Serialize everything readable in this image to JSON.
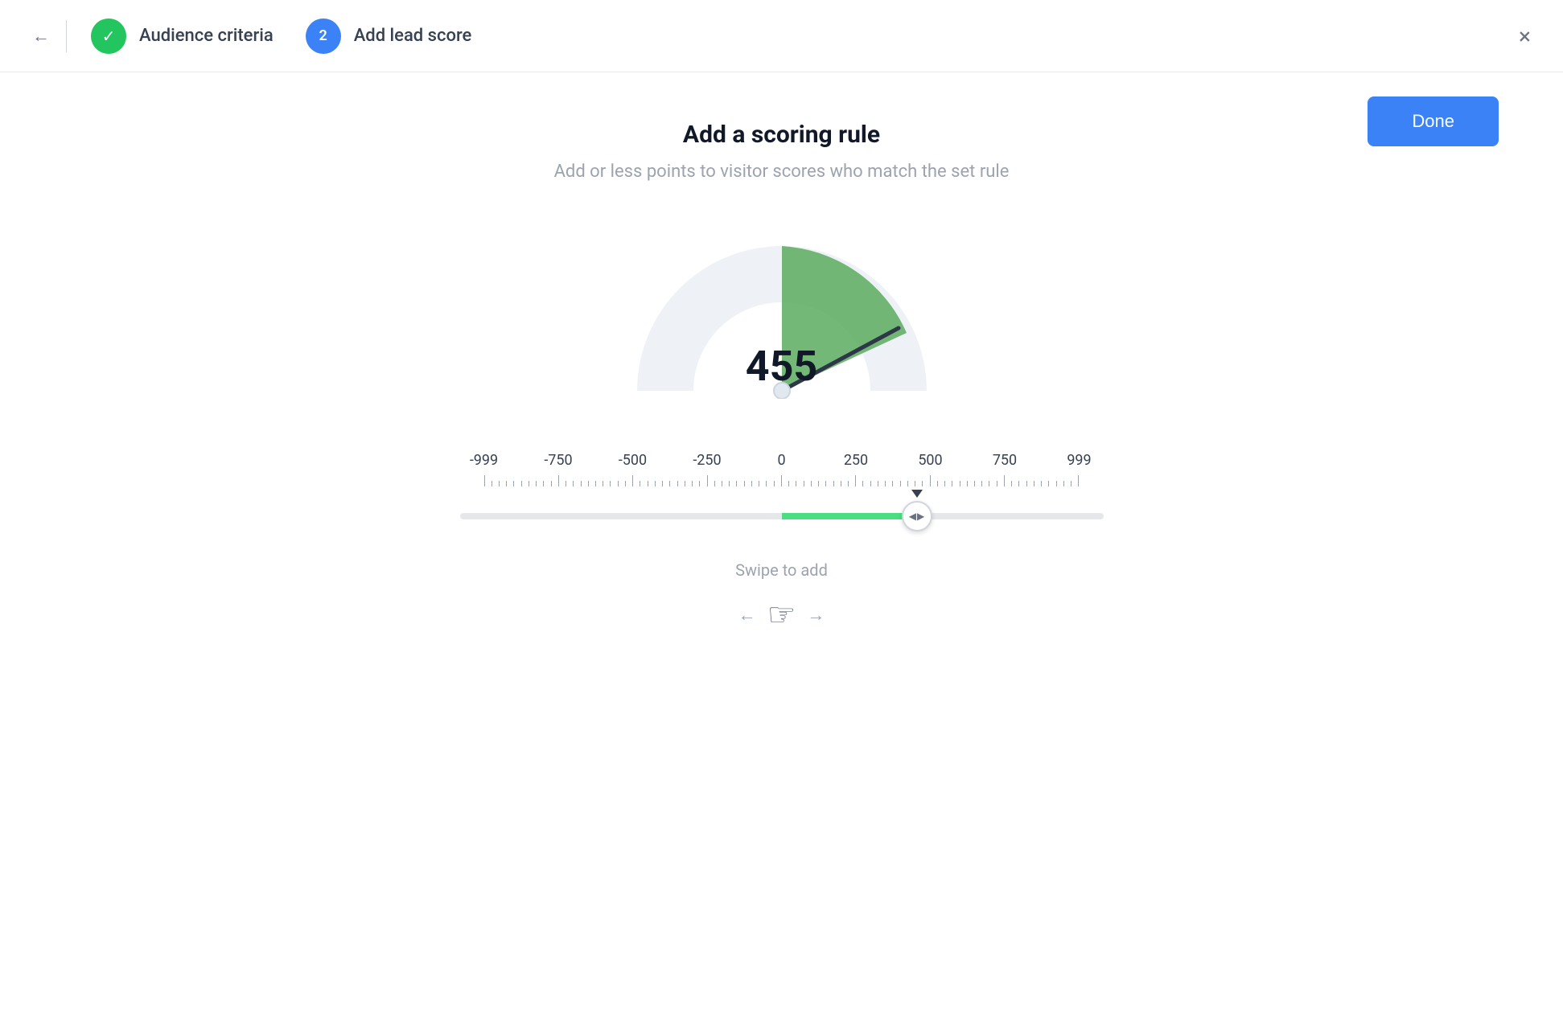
{
  "header": {
    "back_label": "←",
    "step1": {
      "label": "Audience criteria",
      "status": "completed"
    },
    "step2": {
      "number": "2",
      "label": "Add lead score",
      "status": "active"
    },
    "close_label": "×"
  },
  "toolbar": {
    "done_label": "Done"
  },
  "main": {
    "title": "Add a scoring rule",
    "subtitle": "Add or less points to visitor scores who match the set rule",
    "gauge_value": "455",
    "swipe_hint": "Swipe to add"
  },
  "scale": {
    "labels": [
      "-999",
      "-750",
      "-500",
      "-250",
      "0",
      "250",
      "500",
      "750",
      "999"
    ]
  },
  "colors": {
    "completed": "#22c55e",
    "active": "#3b82f6",
    "done_btn": "#3b82f6",
    "gauge_fill": "#5aac5e",
    "slider_fill": "#4ade80"
  }
}
